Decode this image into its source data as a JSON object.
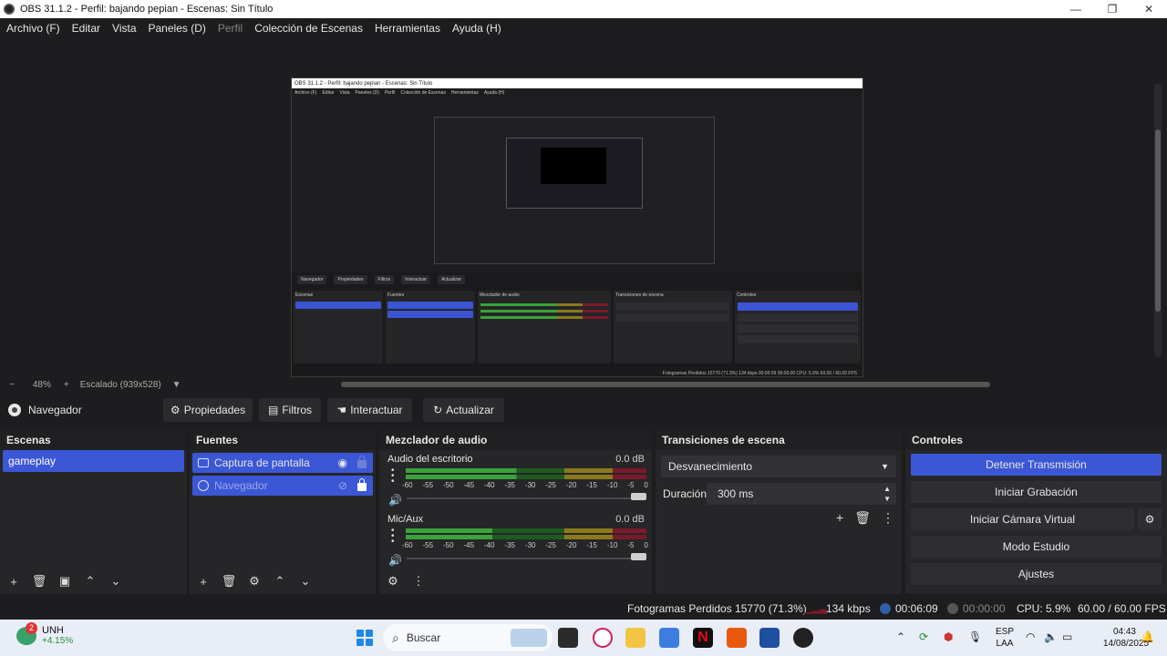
{
  "window": {
    "title": "OBS 31.1.2 - Perfil: bajando pepian - Escenas: Sin Título",
    "minimize": "—",
    "maximize": "❐",
    "close": "✕"
  },
  "menu": [
    "Archivo (F)",
    "Editar",
    "Vista",
    "Paneles (D)",
    "Perfil",
    "Colección de Escenas",
    "Herramientas",
    "Ayuda (H)"
  ],
  "preview": {
    "nested_title": "OBS 31.1.2 - Perfil: bajando pepian - Escenas: Sin Título",
    "nested_menu": [
      "Archivo (F)",
      "Editar",
      "Vista",
      "Paneles (D)",
      "Perfil",
      "Colección de Escenas",
      "Herramientas",
      "Ayuda (H)"
    ],
    "nested_toolbar": [
      "Navegador",
      "Propiedades",
      "Filtros",
      "Interactuar",
      "Actualizar"
    ],
    "nested_status": "Fotogramas Perdidos 15770 (71.3%)   134 kbps   00:06:09   00:00:00   CPU: 5.9%   60.00 / 60.00 FPS"
  },
  "zoom": {
    "minus": "−",
    "level": "48%",
    "plus": "+",
    "scaling": "Escalado (939x528)",
    "caret": "▼"
  },
  "context_bar": {
    "source_name": "Navegador",
    "properties": "Propiedades",
    "filters": "Filtros",
    "interact": "Interactuar",
    "refresh": "Actualizar"
  },
  "scenes": {
    "title": "Escenas",
    "items": [
      "gameplay"
    ]
  },
  "sources": {
    "title": "Fuentes",
    "items": [
      {
        "name": "Captura de pantalla",
        "visible": true,
        "locked": false
      },
      {
        "name": "Navegador",
        "visible": false,
        "locked": true
      }
    ]
  },
  "mixer": {
    "title": "Mezclador de audio",
    "ticks": [
      "-60",
      "-55",
      "-50",
      "-45",
      "-40",
      "-35",
      "-30",
      "-25",
      "-20",
      "-15",
      "-10",
      "-5",
      "0"
    ],
    "channels": [
      {
        "name": "Audio del escritorio",
        "db": "0.0 dB",
        "level_fraction": 0.46
      },
      {
        "name": "Mic/Aux",
        "db": "0.0 dB",
        "level_fraction": 0.36
      }
    ]
  },
  "transitions": {
    "title": "Transiciones de escena",
    "selected": "Desvanecimiento",
    "duration_label": "Duración",
    "duration_value": "300 ms"
  },
  "controls": {
    "title": "Controles",
    "stop_stream": "Detener Transmisión",
    "start_recording": "Iniciar Grabación",
    "start_virtual_cam": "Iniciar Cámara Virtual",
    "studio_mode": "Modo Estudio",
    "settings": "Ajustes"
  },
  "status": {
    "dropped_frames": "Fotogramas Perdidos 15770 (71.3%)",
    "bitrate": "134 kbps",
    "stream_time": "00:06:09",
    "rec_time": "00:00:00",
    "cpu": "CPU: 5.9%",
    "fps": "60.00 / 60.00 FPS"
  },
  "taskbar": {
    "weather_badge": "2",
    "weather_ticker": "UNH",
    "weather_change": "+4.15%",
    "search_placeholder": "Buscar",
    "lang_top": "ESP",
    "lang_bottom": "LAA",
    "time": "04:43",
    "date": "14/08/2025"
  },
  "colors": {
    "accent": "#3b57d6",
    "meter_green": "#3aa33a",
    "meter_yellow": "#8a7a1a",
    "meter_red": "#7a1a2a"
  }
}
